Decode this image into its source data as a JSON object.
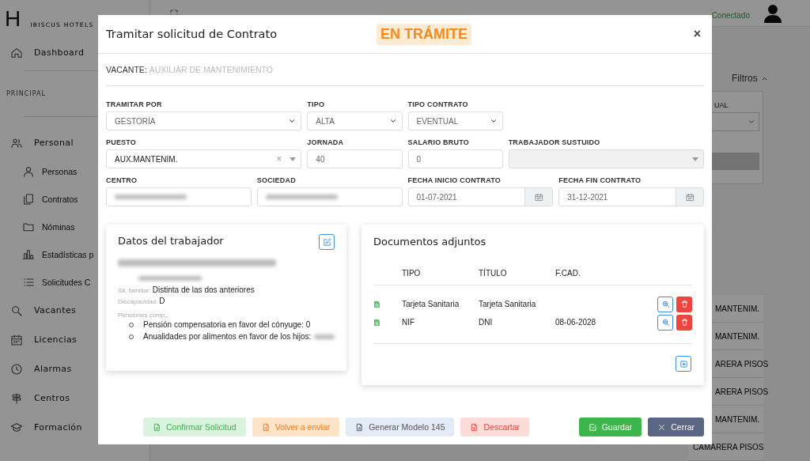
{
  "sidebar": {
    "logo_mark": "H",
    "brand": "IBISCUS HOTELS",
    "top_items": [
      {
        "label": "Dashboard"
      }
    ],
    "section_label": "PRINCIPAL",
    "items": [
      {
        "label": "Personal",
        "children": [
          {
            "label": "Personas"
          },
          {
            "label": "Contratos"
          },
          {
            "label": "Nóminas"
          },
          {
            "label": "Estadísticas p"
          },
          {
            "label": "Solicitudes C"
          }
        ]
      },
      {
        "label": "Vacantes"
      },
      {
        "label": "Licencias"
      },
      {
        "label": "Alarmas"
      },
      {
        "label": "Centros"
      },
      {
        "label": "Formación"
      }
    ]
  },
  "topbar": {
    "status": "Conectado"
  },
  "filters": {
    "title": "Filtros",
    "field_label": "UAL"
  },
  "background_table": {
    "rows": [
      "MANTENIM.",
      "MANTENIM.",
      "ARERA PISOS",
      "ARERA PISOS",
      "MANTENIM.",
      "CAMARERA PISOS"
    ]
  },
  "modal": {
    "title": "Tramitar solicitud de Contrato",
    "status_badge": "EN TRÁMITE",
    "close": "×",
    "vacante": {
      "label": "VACANTE:",
      "value": "AUXILIAR DE MANTENIMIENTO"
    },
    "fields": [
      {
        "kind": "select",
        "label": "TRAMITAR POR",
        "value": "GESTORÍA"
      },
      {
        "kind": "select",
        "label": "TIPO",
        "value": "ALTA"
      },
      {
        "kind": "select",
        "label": "TIPO CONTRATO",
        "value": "EVENTUAL"
      },
      {
        "kind": "combo",
        "label": "PUESTO",
        "value": "AUX.MANTENIM.",
        "clear": "×",
        "disabled": false
      },
      {
        "kind": "input",
        "label": "JORNADA",
        "value": "40"
      },
      {
        "kind": "input",
        "label": "SALARIO BRUTO",
        "value": "0"
      },
      {
        "kind": "combo",
        "label": "TRABAJADOR SUSTUIDO",
        "disabled": true
      },
      {
        "kind": "redacted",
        "label": "CENTRO"
      },
      {
        "kind": "redacted",
        "label": "SOCIEDAD"
      },
      {
        "kind": "date",
        "label": "FECHA INICIO CONTRATO",
        "value": "01-07-2021"
      },
      {
        "kind": "date",
        "label": "FECHA FIN CONTRATO",
        "value": "31-12-2021"
      }
    ],
    "worker": {
      "title": "Datos del trabajador",
      "details": [
        {
          "label": "Sit. familiar:",
          "value": "Distinta de las dos anteriores"
        },
        {
          "label": "Discapacidad:",
          "value": "D"
        }
      ],
      "pensions_label": "Pensiones comp.:",
      "pensions": [
        {
          "text": "Pensión compensatoria en favor del cónyuge: 0",
          "redacted": false
        },
        {
          "text": "Anualidades por alimentos en favor de los hijos:",
          "redacted": true
        }
      ]
    },
    "documents": {
      "title": "Documentos adjuntos",
      "columns": [
        "TIPO",
        "TÍTULO",
        "F.CAD."
      ],
      "rows": [
        {
          "tipo": "Tarjeta Sanitaria",
          "titulo": "Tarjeta Sanitaria"
        },
        {
          "tipo": "NIF",
          "titulo": "DNI",
          "fcad": "08-06-2028"
        }
      ]
    },
    "buttons": [
      {
        "kind": "confirm",
        "label": "Confirmar Solicitud"
      },
      {
        "kind": "resend",
        "label": "Volver a enviar"
      },
      {
        "kind": "generate",
        "label": "Generar Modelo 145"
      },
      {
        "kind": "discard",
        "label": "Descartar"
      },
      {
        "kind": "save",
        "label": "Guardar"
      },
      {
        "kind": "close",
        "label": "Cerrar"
      }
    ]
  }
}
